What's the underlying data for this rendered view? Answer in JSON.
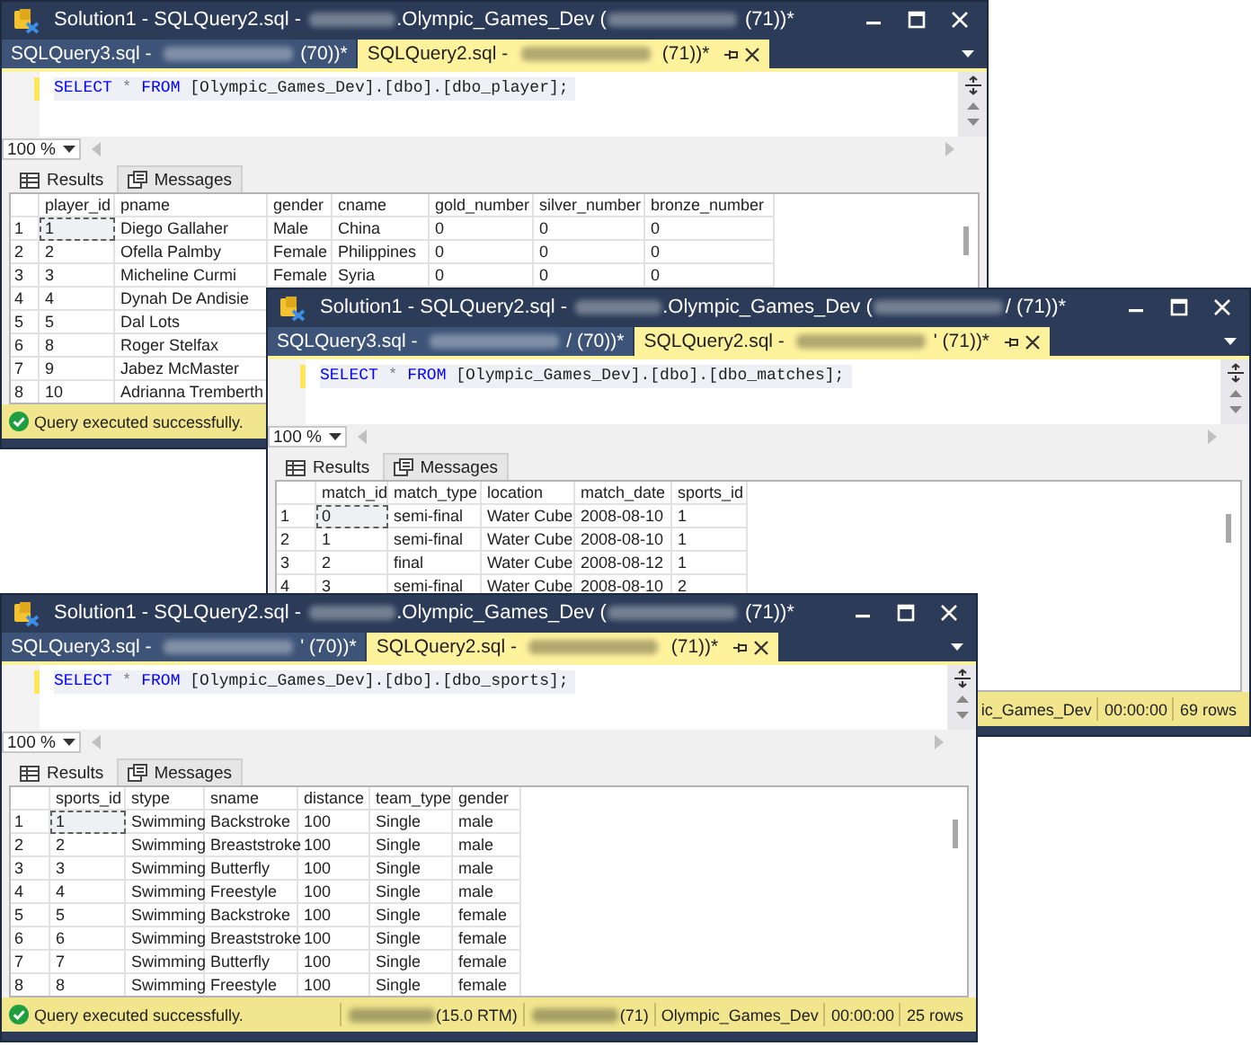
{
  "windows": [
    {
      "title": [
        {
          "kind": "text",
          "text": "Solution1 - SQLQuery2.sql - "
        },
        {
          "kind": "blurred"
        },
        {
          "kind": "text",
          "text": ".Olympic_Games_Dev ("
        },
        {
          "kind": "blurred"
        },
        {
          "kind": "text",
          "text": " (71))*"
        }
      ],
      "tabs": [
        {
          "selected": false,
          "parts": [
            {
              "kind": "text",
              "text": "SQLQuery3.sql - "
            },
            {
              "kind": "blurred"
            },
            {
              "kind": "text",
              "text": "(70))*"
            }
          ]
        },
        {
          "selected": true,
          "parts": [
            {
              "kind": "text",
              "text": "SQLQuery2.sql - "
            },
            {
              "kind": "blurred"
            },
            {
              "kind": "text",
              "text": " (71))*"
            }
          ]
        }
      ],
      "query": [
        {
          "kind": "keyword",
          "text": "SELECT"
        },
        {
          "kind": "operator",
          "text": "*"
        },
        {
          "kind": "keyword",
          "text": "FROM"
        },
        {
          "kind": "plain",
          "text": "[Olympic_Games_Dev].[dbo].[dbo_player];"
        }
      ],
      "zoom": "100 %",
      "result_tabs": [
        {
          "label": "Results",
          "selected": true
        },
        {
          "label": "Messages",
          "selected": false
        }
      ],
      "table": {
        "columns": [
          "player_id",
          "pname",
          "gender",
          "cname",
          "gold_number",
          "silver_number",
          "bronze_number"
        ],
        "rows": [
          {
            "number": "1",
            "focused": true,
            "cells": [
              "1",
              "Diego Gallaher",
              "Male",
              "China",
              "0",
              "0",
              "0"
            ]
          },
          {
            "number": "2",
            "focused": false,
            "cells": [
              "2",
              "Ofella Palmby",
              "Female",
              "Philippines",
              "0",
              "0",
              "0"
            ]
          },
          {
            "number": "3",
            "focused": false,
            "cells": [
              "3",
              "Micheline Curmi",
              "Female",
              "Syria",
              "0",
              "0",
              "0"
            ]
          },
          {
            "number": "4",
            "focused": false,
            "cells": [
              "4",
              "Dynah De Andisie"
            ]
          },
          {
            "number": "5",
            "focused": false,
            "cells": [
              "5",
              "Dal Lots"
            ]
          },
          {
            "number": "6",
            "focused": false,
            "cells": [
              "8",
              "Roger Stelfax"
            ]
          },
          {
            "number": "7",
            "focused": false,
            "cells": [
              "9",
              "Jabez McMaster"
            ]
          },
          {
            "number": "8",
            "focused": false,
            "cells": [
              "10",
              "Adrianna Tremberth"
            ]
          }
        ]
      },
      "status_bar": {
        "message": "Query executed successfully."
      }
    },
    {
      "title": [
        {
          "kind": "text",
          "text": "Solution1 - SQLQuery2.sql - "
        },
        {
          "kind": "blurred"
        },
        {
          "kind": "text",
          "text": ".Olympic_Games_Dev ("
        },
        {
          "kind": "blurred"
        },
        {
          "kind": "text",
          "text": "/ (71))*"
        }
      ],
      "tabs": [
        {
          "selected": false,
          "parts": [
            {
              "kind": "text",
              "text": "SQLQuery3.sql - "
            },
            {
              "kind": "blurred"
            },
            {
              "kind": "text",
              "text": "/ (70))*"
            }
          ]
        },
        {
          "selected": true,
          "parts": [
            {
              "kind": "text",
              "text": "SQLQuery2.sql - "
            },
            {
              "kind": "blurred"
            },
            {
              "kind": "text",
              "text": "' (71))*"
            }
          ]
        }
      ],
      "query": [
        {
          "kind": "keyword",
          "text": "SELECT"
        },
        {
          "kind": "operator",
          "text": "*"
        },
        {
          "kind": "keyword",
          "text": "FROM"
        },
        {
          "kind": "plain",
          "text": "[Olympic_Games_Dev].[dbo].[dbo_matches];"
        }
      ],
      "zoom": "100 %",
      "result_tabs": [
        {
          "label": "Results",
          "selected": true
        },
        {
          "label": "Messages",
          "selected": false
        }
      ],
      "table": {
        "columns": [
          "match_id",
          "match_type",
          "location",
          "match_date",
          "sports_id"
        ],
        "rows": [
          {
            "number": "1",
            "focused": true,
            "cells": [
              "0",
              "semi-final",
              "Water Cube",
              "2008-08-10",
              "1"
            ]
          },
          {
            "number": "2",
            "focused": false,
            "cells": [
              "1",
              "semi-final",
              "Water Cube",
              "2008-08-10",
              "1"
            ]
          },
          {
            "number": "3",
            "focused": false,
            "cells": [
              "2",
              "final",
              "Water Cube",
              "2008-08-12",
              "1"
            ]
          },
          {
            "number": "4",
            "focused": false,
            "cells": [
              "3",
              "semi-final",
              "Water Cube",
              "2008-08-10",
              "2"
            ]
          }
        ]
      },
      "status_bar": {
        "fields": [
          {
            "parts": [
              {
                "kind": "text",
                "text": "ic_Games_Dev"
              }
            ]
          },
          {
            "parts": [
              {
                "kind": "text",
                "text": "00:00:00"
              }
            ]
          },
          {
            "parts": [
              {
                "kind": "text",
                "text": "69 rows"
              }
            ]
          }
        ]
      }
    },
    {
      "title": [
        {
          "kind": "text",
          "text": "Solution1 - SQLQuery2.sql - "
        },
        {
          "kind": "blurred"
        },
        {
          "kind": "text",
          "text": ".Olympic_Games_Dev ("
        },
        {
          "kind": "blurred"
        },
        {
          "kind": "text",
          "text": " (71))*"
        }
      ],
      "tabs": [
        {
          "selected": false,
          "parts": [
            {
              "kind": "text",
              "text": "SQLQuery3.sql - "
            },
            {
              "kind": "blurred"
            },
            {
              "kind": "text",
              "text": "' (70))*"
            }
          ]
        },
        {
          "selected": true,
          "parts": [
            {
              "kind": "text",
              "text": "SQLQuery2.sql - "
            },
            {
              "kind": "blurred"
            },
            {
              "kind": "text",
              "text": " (71))*"
            }
          ]
        }
      ],
      "query": [
        {
          "kind": "keyword",
          "text": "SELECT"
        },
        {
          "kind": "operator",
          "text": "*"
        },
        {
          "kind": "keyword",
          "text": "FROM"
        },
        {
          "kind": "plain",
          "text": "[Olympic_Games_Dev].[dbo].[dbo_sports];"
        }
      ],
      "zoom": "100 %",
      "result_tabs": [
        {
          "label": "Results",
          "selected": true
        },
        {
          "label": "Messages",
          "selected": false
        }
      ],
      "table": {
        "columns": [
          "sports_id",
          "stype",
          "sname",
          "distance",
          "team_type",
          "gender"
        ],
        "rows": [
          {
            "number": "1",
            "focused": true,
            "cells": [
              "1",
              "Swimming",
              "Backstroke",
              "100",
              "Single",
              "male"
            ]
          },
          {
            "number": "2",
            "focused": false,
            "cells": [
              "2",
              "Swimming",
              "Breaststroke",
              "100",
              "Single",
              "male"
            ]
          },
          {
            "number": "3",
            "focused": false,
            "cells": [
              "3",
              "Swimming",
              "Butterfly",
              "100",
              "Single",
              "male"
            ]
          },
          {
            "number": "4",
            "focused": false,
            "cells": [
              "4",
              "Swimming",
              "Freestyle",
              "100",
              "Single",
              "male"
            ]
          },
          {
            "number": "5",
            "focused": false,
            "cells": [
              "5",
              "Swimming",
              "Backstroke",
              "100",
              "Single",
              "female"
            ]
          },
          {
            "number": "6",
            "focused": false,
            "cells": [
              "6",
              "Swimming",
              "Breaststroke",
              "100",
              "Single",
              "female"
            ]
          },
          {
            "number": "7",
            "focused": false,
            "cells": [
              "7",
              "Swimming",
              "Butterfly",
              "100",
              "Single",
              "female"
            ]
          },
          {
            "number": "8",
            "focused": false,
            "cells": [
              "8",
              "Swimming",
              "Freestyle",
              "100",
              "Single",
              "female"
            ]
          }
        ]
      },
      "status_bar": {
        "message": "Query executed successfully.",
        "fields": [
          {
            "parts": [
              {
                "kind": "blurred"
              },
              {
                "kind": "text",
                "text": "(15.0 RTM)"
              }
            ]
          },
          {
            "parts": [
              {
                "kind": "blurred"
              },
              {
                "kind": "text",
                "text": "(71)"
              }
            ]
          },
          {
            "parts": [
              {
                "kind": "text",
                "text": "Olympic_Games_Dev"
              }
            ]
          },
          {
            "parts": [
              {
                "kind": "text",
                "text": "00:00:00"
              }
            ]
          },
          {
            "parts": [
              {
                "kind": "text",
                "text": "25 rows"
              }
            ]
          }
        ]
      }
    }
  ]
}
